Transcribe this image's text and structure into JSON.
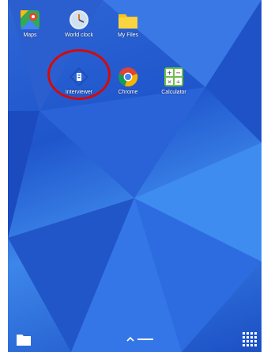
{
  "home": {
    "apps": [
      {
        "label": "Maps",
        "icon": "maps-icon"
      },
      {
        "label": "World clock",
        "icon": "world-clock-icon"
      },
      {
        "label": "My Files",
        "icon": "folder-icon"
      },
      {
        "label": "Interviewer",
        "icon": "interviewer-icon"
      },
      {
        "label": "Chrome",
        "icon": "chrome-icon"
      },
      {
        "label": "Calculator",
        "icon": "calculator-icon"
      }
    ],
    "highlight": {
      "target": "Interviewer",
      "color": "#d40a0a"
    }
  },
  "dock": {
    "left_icon": "folder-icon",
    "center_icons": [
      "chevron-up-icon",
      "dash-icon"
    ],
    "right_icon": "app-grid-icon"
  },
  "colors": {
    "wallpaper": "#2f67d6"
  }
}
